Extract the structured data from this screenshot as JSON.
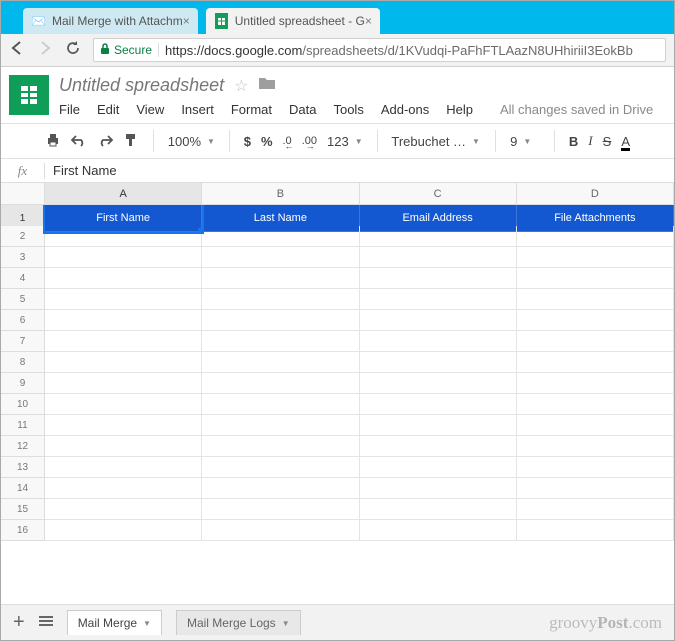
{
  "browser": {
    "tabs": [
      {
        "title": "Mail Merge with Attachm"
      },
      {
        "title": "Untitled spreadsheet - G"
      }
    ],
    "secure_label": "Secure",
    "url_host": "https://docs.google.com",
    "url_rest": "/spreadsheets/d/1KVudqi-PaFhFTLAazN8UHhiriiI3EokBb"
  },
  "doc": {
    "title": "Untitled spreadsheet",
    "menus": [
      "File",
      "Edit",
      "View",
      "Insert",
      "Format",
      "Data",
      "Tools",
      "Add-ons",
      "Help"
    ],
    "save_status": "All changes saved in Drive"
  },
  "toolbar": {
    "zoom": "100%",
    "currency": "$",
    "percent": "%",
    "dec_less": ".0",
    "dec_more": ".00",
    "format_more": "123",
    "font": "Trebuchet …",
    "font_size": "9"
  },
  "formula_bar": {
    "value": "First Name"
  },
  "grid": {
    "columns": [
      "A",
      "B",
      "C",
      "D"
    ],
    "header_cells": [
      "First Name",
      "Last Name",
      "Email Address",
      "File Attachments"
    ],
    "row_count": 16
  },
  "sheets": {
    "tabs": [
      "Mail Merge",
      "Mail Merge Logs"
    ]
  },
  "watermark": {
    "brand": "groovy",
    "suffix": "Post",
    "tld": ".com"
  }
}
